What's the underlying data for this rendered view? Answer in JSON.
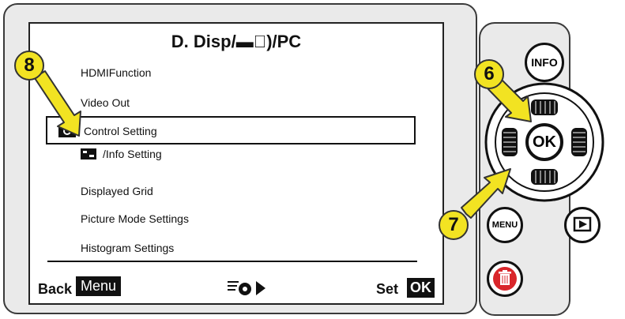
{
  "screen": {
    "title": "D. Disp/▬⃒)/PC",
    "menu_items": [
      {
        "label": "HDMIFunction"
      },
      {
        "label": "Video Out"
      },
      {
        "label": "Control Setting"
      },
      {
        "label": "/Info Setting"
      },
      {
        "label": "Displayed Grid"
      },
      {
        "label": "Picture Mode Settings"
      },
      {
        "label": "Histogram Settings"
      }
    ],
    "footer": {
      "back_label": "Back",
      "menu_label": "Menu",
      "set_label": "Set",
      "ok_label": "OK"
    }
  },
  "buttons": {
    "info_label": "INFO",
    "ok_label": "OK",
    "menu_label": "MENU"
  },
  "callouts": [
    "8",
    "6",
    "7"
  ],
  "colors": {
    "callout_fill": "#f2e322",
    "delete_red": "#d9262b"
  }
}
